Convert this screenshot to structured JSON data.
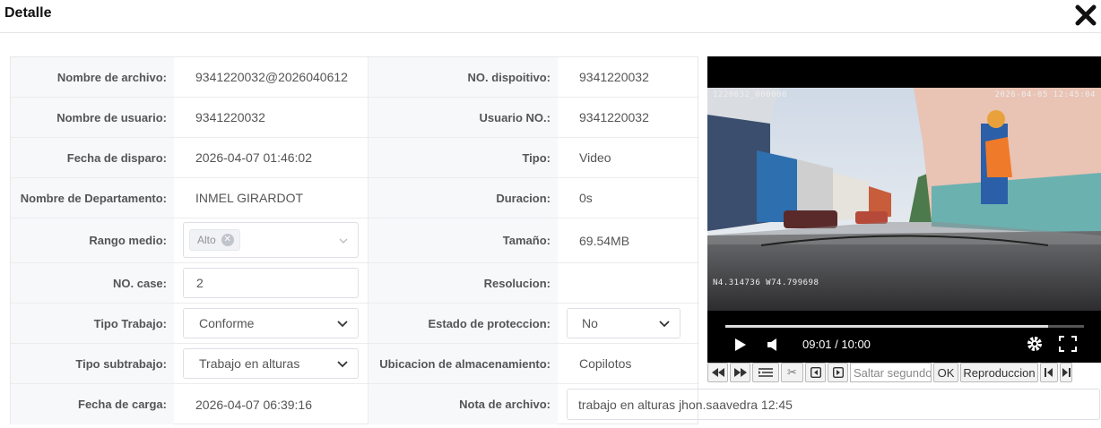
{
  "dialog": {
    "title": "Detalle",
    "close_icon": "close-icon"
  },
  "labels": {
    "nombre_archivo": "Nombre de archivo:",
    "no_dispositivo": "NO. dispoitivo:",
    "nombre_usuario": "Nombre de usuario:",
    "usuario_no": "Usuario NO.:",
    "fecha_disparo": "Fecha de disparo:",
    "tipo": "Tipo:",
    "departamento": "Nombre de Departamento:",
    "duracion": "Duracion:",
    "rango_medio": "Rango medio:",
    "tamano": "Tamaño:",
    "no_case": "NO. case:",
    "resolucion": "Resolucion:",
    "tipo_trabajo": "Tipo Trabajo:",
    "estado_proteccion": "Estado de proteccion:",
    "tipo_subtrabajo": "Tipo subtrabajo:",
    "ubicacion": "Ubicacion de almacenamiento:",
    "fecha_carga": "Fecha de carga:",
    "nota_archivo": "Nota de archivo:"
  },
  "values": {
    "nombre_archivo": "9341220032@2026040612",
    "no_dispositivo": "9341220032",
    "nombre_usuario": "9341220032",
    "usuario_no": "9341220032",
    "fecha_disparo": "2026-04-07 01:46:02",
    "tipo": "Video",
    "departamento": "INMEL GIRARDOT",
    "duracion": "0s",
    "rango_medio_tag": "Alto",
    "tamano": "69.54MB",
    "no_case": "2",
    "resolucion": "",
    "tipo_trabajo": "Conforme",
    "estado_proteccion": "No",
    "tipo_subtrabajo": "Trabajo en alturas",
    "ubicacion": "Copilotos",
    "fecha_carga": "2026-04-07 06:39:16",
    "nota_archivo": "trabajo en alturas jhon.saavedra 12:45"
  },
  "player": {
    "overlay_top_left": "1220032_000000",
    "overlay_top_right": "2026-04-05 12:45:04",
    "overlay_gps": "N4.314736  W74.799698",
    "time": "09:01 / 10:00",
    "progress": 0.9
  },
  "toolbar": {
    "seek_placeholder": "Saltar segundos",
    "ok_label": "OK",
    "playback_label": "Reproduccion"
  }
}
